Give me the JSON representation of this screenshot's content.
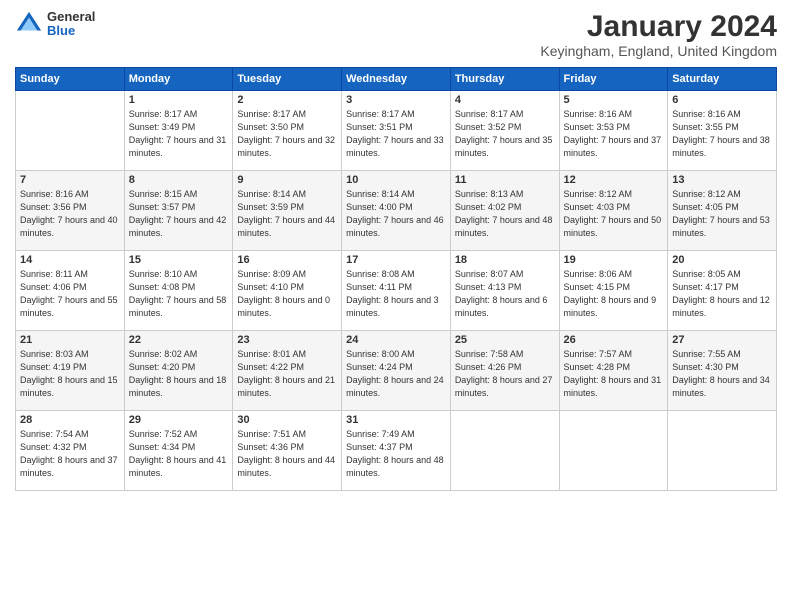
{
  "logo": {
    "general": "General",
    "blue": "Blue"
  },
  "title": {
    "month": "January 2024",
    "location": "Keyingham, England, United Kingdom"
  },
  "days_of_week": [
    "Sunday",
    "Monday",
    "Tuesday",
    "Wednesday",
    "Thursday",
    "Friday",
    "Saturday"
  ],
  "weeks": [
    [
      {
        "day": "",
        "sunrise": "",
        "sunset": "",
        "daylight": ""
      },
      {
        "day": "1",
        "sunrise": "Sunrise: 8:17 AM",
        "sunset": "Sunset: 3:49 PM",
        "daylight": "Daylight: 7 hours and 31 minutes."
      },
      {
        "day": "2",
        "sunrise": "Sunrise: 8:17 AM",
        "sunset": "Sunset: 3:50 PM",
        "daylight": "Daylight: 7 hours and 32 minutes."
      },
      {
        "day": "3",
        "sunrise": "Sunrise: 8:17 AM",
        "sunset": "Sunset: 3:51 PM",
        "daylight": "Daylight: 7 hours and 33 minutes."
      },
      {
        "day": "4",
        "sunrise": "Sunrise: 8:17 AM",
        "sunset": "Sunset: 3:52 PM",
        "daylight": "Daylight: 7 hours and 35 minutes."
      },
      {
        "day": "5",
        "sunrise": "Sunrise: 8:16 AM",
        "sunset": "Sunset: 3:53 PM",
        "daylight": "Daylight: 7 hours and 37 minutes."
      },
      {
        "day": "6",
        "sunrise": "Sunrise: 8:16 AM",
        "sunset": "Sunset: 3:55 PM",
        "daylight": "Daylight: 7 hours and 38 minutes."
      }
    ],
    [
      {
        "day": "7",
        "sunrise": "Sunrise: 8:16 AM",
        "sunset": "Sunset: 3:56 PM",
        "daylight": "Daylight: 7 hours and 40 minutes."
      },
      {
        "day": "8",
        "sunrise": "Sunrise: 8:15 AM",
        "sunset": "Sunset: 3:57 PM",
        "daylight": "Daylight: 7 hours and 42 minutes."
      },
      {
        "day": "9",
        "sunrise": "Sunrise: 8:14 AM",
        "sunset": "Sunset: 3:59 PM",
        "daylight": "Daylight: 7 hours and 44 minutes."
      },
      {
        "day": "10",
        "sunrise": "Sunrise: 8:14 AM",
        "sunset": "Sunset: 4:00 PM",
        "daylight": "Daylight: 7 hours and 46 minutes."
      },
      {
        "day": "11",
        "sunrise": "Sunrise: 8:13 AM",
        "sunset": "Sunset: 4:02 PM",
        "daylight": "Daylight: 7 hours and 48 minutes."
      },
      {
        "day": "12",
        "sunrise": "Sunrise: 8:12 AM",
        "sunset": "Sunset: 4:03 PM",
        "daylight": "Daylight: 7 hours and 50 minutes."
      },
      {
        "day": "13",
        "sunrise": "Sunrise: 8:12 AM",
        "sunset": "Sunset: 4:05 PM",
        "daylight": "Daylight: 7 hours and 53 minutes."
      }
    ],
    [
      {
        "day": "14",
        "sunrise": "Sunrise: 8:11 AM",
        "sunset": "Sunset: 4:06 PM",
        "daylight": "Daylight: 7 hours and 55 minutes."
      },
      {
        "day": "15",
        "sunrise": "Sunrise: 8:10 AM",
        "sunset": "Sunset: 4:08 PM",
        "daylight": "Daylight: 7 hours and 58 minutes."
      },
      {
        "day": "16",
        "sunrise": "Sunrise: 8:09 AM",
        "sunset": "Sunset: 4:10 PM",
        "daylight": "Daylight: 8 hours and 0 minutes."
      },
      {
        "day": "17",
        "sunrise": "Sunrise: 8:08 AM",
        "sunset": "Sunset: 4:11 PM",
        "daylight": "Daylight: 8 hours and 3 minutes."
      },
      {
        "day": "18",
        "sunrise": "Sunrise: 8:07 AM",
        "sunset": "Sunset: 4:13 PM",
        "daylight": "Daylight: 8 hours and 6 minutes."
      },
      {
        "day": "19",
        "sunrise": "Sunrise: 8:06 AM",
        "sunset": "Sunset: 4:15 PM",
        "daylight": "Daylight: 8 hours and 9 minutes."
      },
      {
        "day": "20",
        "sunrise": "Sunrise: 8:05 AM",
        "sunset": "Sunset: 4:17 PM",
        "daylight": "Daylight: 8 hours and 12 minutes."
      }
    ],
    [
      {
        "day": "21",
        "sunrise": "Sunrise: 8:03 AM",
        "sunset": "Sunset: 4:19 PM",
        "daylight": "Daylight: 8 hours and 15 minutes."
      },
      {
        "day": "22",
        "sunrise": "Sunrise: 8:02 AM",
        "sunset": "Sunset: 4:20 PM",
        "daylight": "Daylight: 8 hours and 18 minutes."
      },
      {
        "day": "23",
        "sunrise": "Sunrise: 8:01 AM",
        "sunset": "Sunset: 4:22 PM",
        "daylight": "Daylight: 8 hours and 21 minutes."
      },
      {
        "day": "24",
        "sunrise": "Sunrise: 8:00 AM",
        "sunset": "Sunset: 4:24 PM",
        "daylight": "Daylight: 8 hours and 24 minutes."
      },
      {
        "day": "25",
        "sunrise": "Sunrise: 7:58 AM",
        "sunset": "Sunset: 4:26 PM",
        "daylight": "Daylight: 8 hours and 27 minutes."
      },
      {
        "day": "26",
        "sunrise": "Sunrise: 7:57 AM",
        "sunset": "Sunset: 4:28 PM",
        "daylight": "Daylight: 8 hours and 31 minutes."
      },
      {
        "day": "27",
        "sunrise": "Sunrise: 7:55 AM",
        "sunset": "Sunset: 4:30 PM",
        "daylight": "Daylight: 8 hours and 34 minutes."
      }
    ],
    [
      {
        "day": "28",
        "sunrise": "Sunrise: 7:54 AM",
        "sunset": "Sunset: 4:32 PM",
        "daylight": "Daylight: 8 hours and 37 minutes."
      },
      {
        "day": "29",
        "sunrise": "Sunrise: 7:52 AM",
        "sunset": "Sunset: 4:34 PM",
        "daylight": "Daylight: 8 hours and 41 minutes."
      },
      {
        "day": "30",
        "sunrise": "Sunrise: 7:51 AM",
        "sunset": "Sunset: 4:36 PM",
        "daylight": "Daylight: 8 hours and 44 minutes."
      },
      {
        "day": "31",
        "sunrise": "Sunrise: 7:49 AM",
        "sunset": "Sunset: 4:37 PM",
        "daylight": "Daylight: 8 hours and 48 minutes."
      },
      {
        "day": "",
        "sunrise": "",
        "sunset": "",
        "daylight": ""
      },
      {
        "day": "",
        "sunrise": "",
        "sunset": "",
        "daylight": ""
      },
      {
        "day": "",
        "sunrise": "",
        "sunset": "",
        "daylight": ""
      }
    ]
  ]
}
